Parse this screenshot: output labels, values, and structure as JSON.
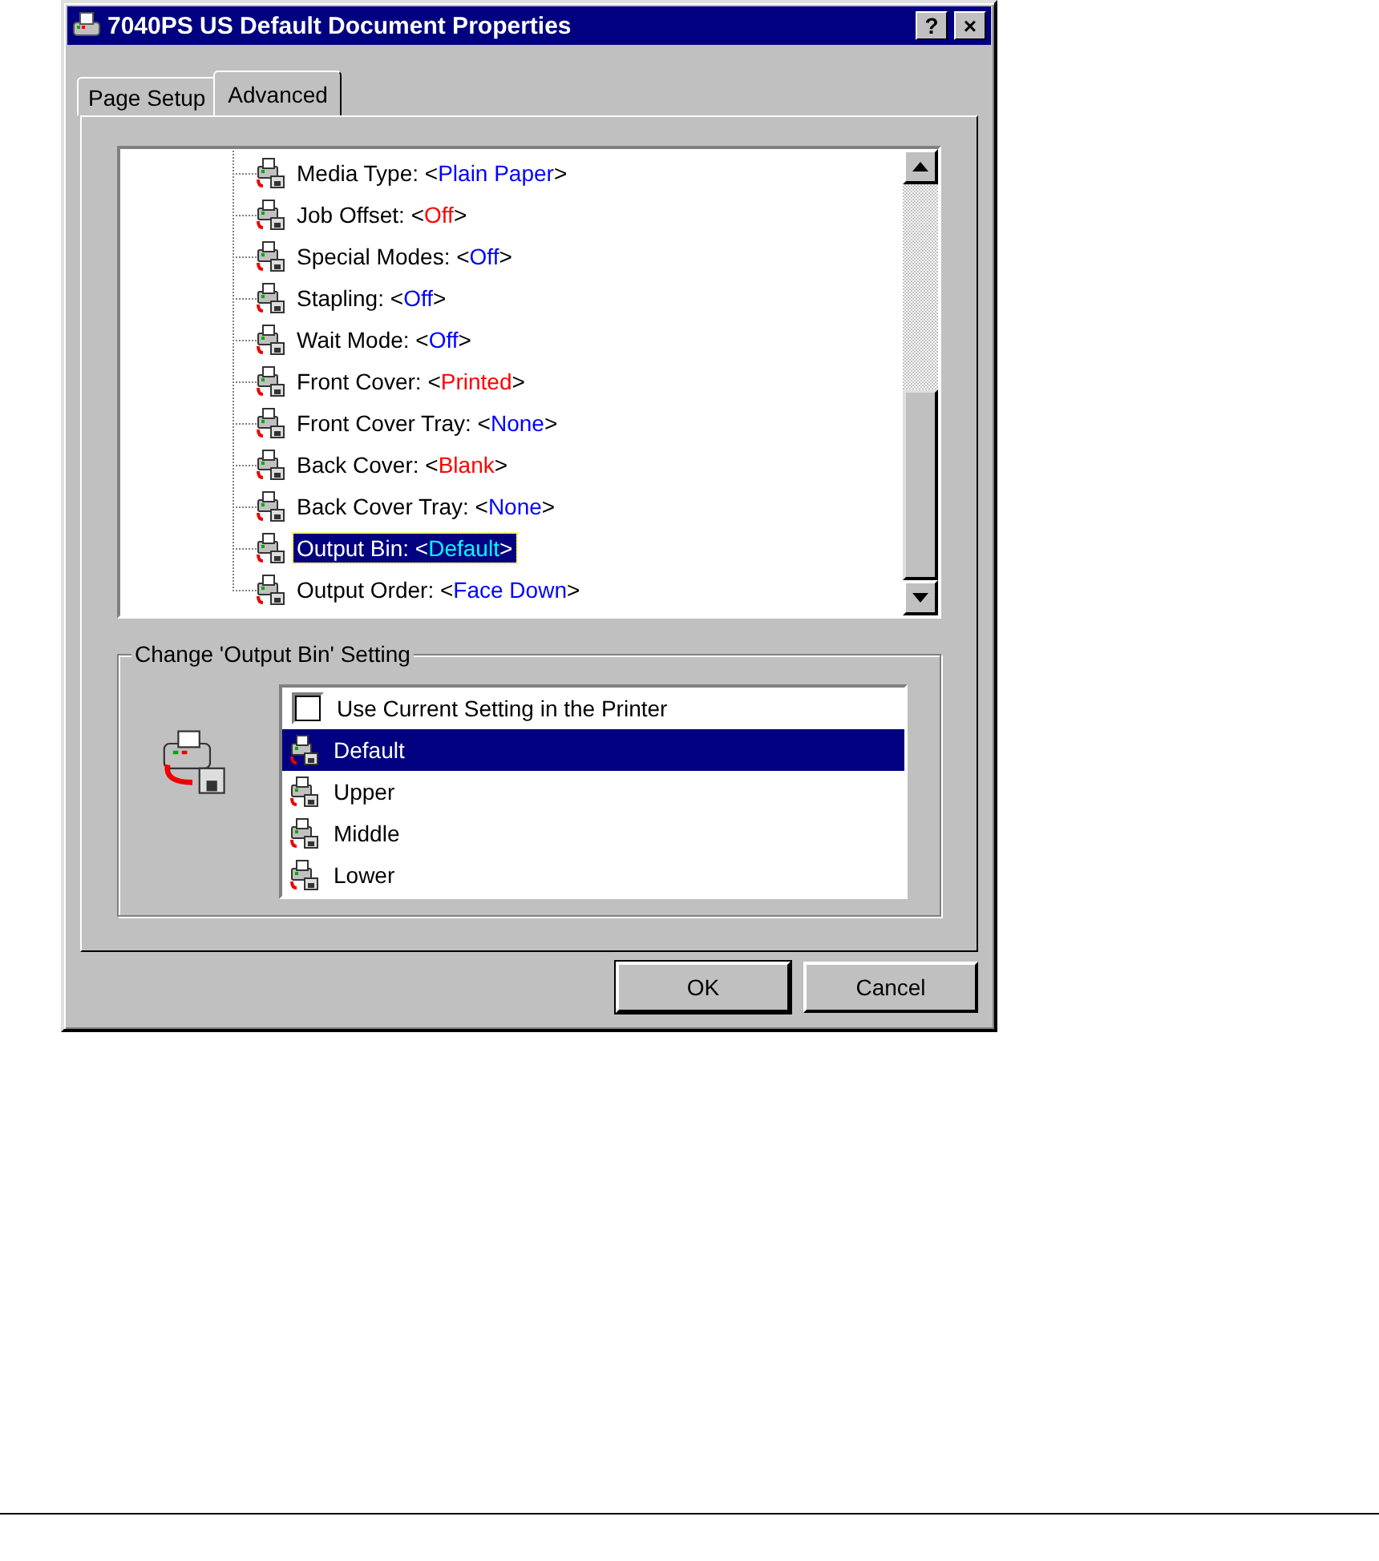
{
  "window": {
    "title": "7040PS US Default Document Properties",
    "buttons": [
      "?",
      "×"
    ]
  },
  "tabs": [
    {
      "label": "Page Setup",
      "selected": false
    },
    {
      "label": "Advanced",
      "selected": true
    }
  ],
  "tree": {
    "items": [
      {
        "name": "Media Type: <",
        "value": "Plain Paper",
        "end": ">",
        "color": "#0000ff",
        "selected": false
      },
      {
        "name": "Job Offset: <",
        "value": "Off",
        "end": ">",
        "color": "#ff0000",
        "selected": false
      },
      {
        "name": "Special Modes: <",
        "value": "Off",
        "end": ">",
        "color": "#0000ff",
        "selected": false
      },
      {
        "name": "Stapling: <",
        "value": "Off",
        "end": ">",
        "color": "#0000ff",
        "selected": false
      },
      {
        "name": "Wait Mode: <",
        "value": "Off",
        "end": ">",
        "color": "#0000ff",
        "selected": false
      },
      {
        "name": "Front Cover: <",
        "value": "Printed",
        "end": ">",
        "color": "#ff0000",
        "selected": false
      },
      {
        "name": "Front Cover Tray: <",
        "value": "None",
        "end": ">",
        "color": "#0000ff",
        "selected": false
      },
      {
        "name": "Back Cover: <",
        "value": "Blank",
        "end": ">",
        "color": "#ff0000",
        "selected": false
      },
      {
        "name": "Back Cover Tray: <",
        "value": "None",
        "end": ">",
        "color": "#0000ff",
        "selected": false
      },
      {
        "name": "Output Bin: <",
        "value": "Default",
        "end": ">",
        "color": "#00ffff",
        "selected": true
      },
      {
        "name": "Output Order: <",
        "value": "Face Down",
        "end": ">",
        "color": "#0000ff",
        "selected": false
      }
    ]
  },
  "setting": {
    "title": "Change 'Output Bin' Setting",
    "options": [
      {
        "kind": "checkbox",
        "label": "Use Current Setting in the Printer",
        "checked": false
      },
      {
        "kind": "option",
        "label": "Default",
        "selected": true
      },
      {
        "kind": "option",
        "label": "Upper",
        "selected": false
      },
      {
        "kind": "option",
        "label": "Middle",
        "selected": false
      },
      {
        "kind": "option",
        "label": "Lower",
        "selected": false
      }
    ]
  },
  "buttons": [
    "OK",
    "Cancel"
  ]
}
